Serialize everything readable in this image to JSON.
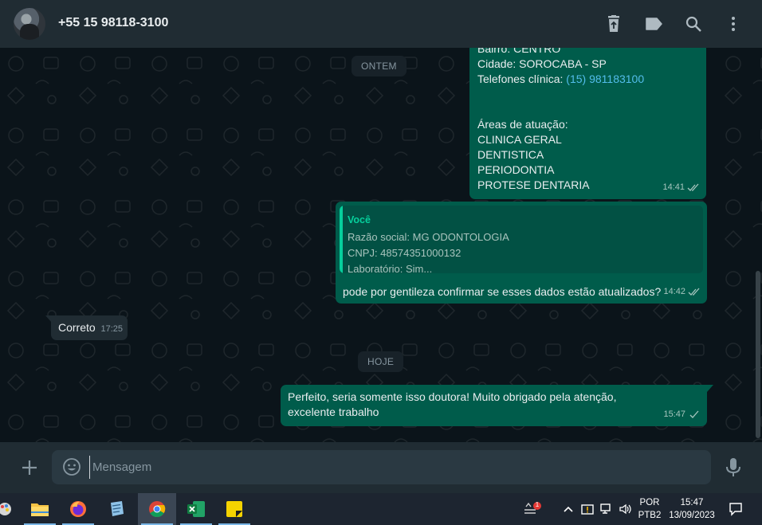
{
  "header": {
    "contact_name": "+55 15 98118-3100",
    "icons": [
      "trash-icon",
      "label-icon",
      "search-icon",
      "menu-icon"
    ]
  },
  "chips": {
    "yesterday": "ONTEM",
    "today": "HOJE"
  },
  "messages": {
    "m1": {
      "lines": [
        "Bairro: CENTRO",
        "Cidade: SOROCABA - SP"
      ],
      "phone_label": "Telefones clínica: ",
      "phone_value": "(15) 981183100",
      "areas_title": "Áreas de atuação:",
      "areas": [
        "CLINICA GERAL",
        "DENTISTICA",
        "PERIODONTIA",
        "PROTESE DENTARIA"
      ],
      "time": "14:41"
    },
    "m2": {
      "quote_author": "Você",
      "quote_lines": [
        "Razão social: MG ODONTOLOGIA",
        "CNPJ: 48574351000132",
        "Laboratório: Sim..."
      ],
      "text": "pode por gentileza confirmar se esses dados estão atualizados?",
      "time": "14:42"
    },
    "m3": {
      "text": "Correto",
      "time": "17:25"
    },
    "m4": {
      "text": "Perfeito, seria somente isso doutora! Muito obrigado pela atenção, excelente trabalho",
      "time": "15:47"
    }
  },
  "composer": {
    "placeholder": "Mensagem"
  },
  "taskbar": {
    "apps": [
      "file-explorer-icon",
      "firefox-icon",
      "notes-app-icon",
      "chrome-icon",
      "excel-icon",
      "sticky-notes-icon"
    ],
    "lang_line1": "POR",
    "lang_line2": "PTB2",
    "clock_time": "15:47",
    "clock_date": "13/09/2023",
    "notification_count": "1"
  },
  "colors": {
    "outgoing_bubble": "#005c4b",
    "incoming_bubble": "#202c33",
    "accent": "#06cf9c",
    "link": "#53bdeb"
  }
}
